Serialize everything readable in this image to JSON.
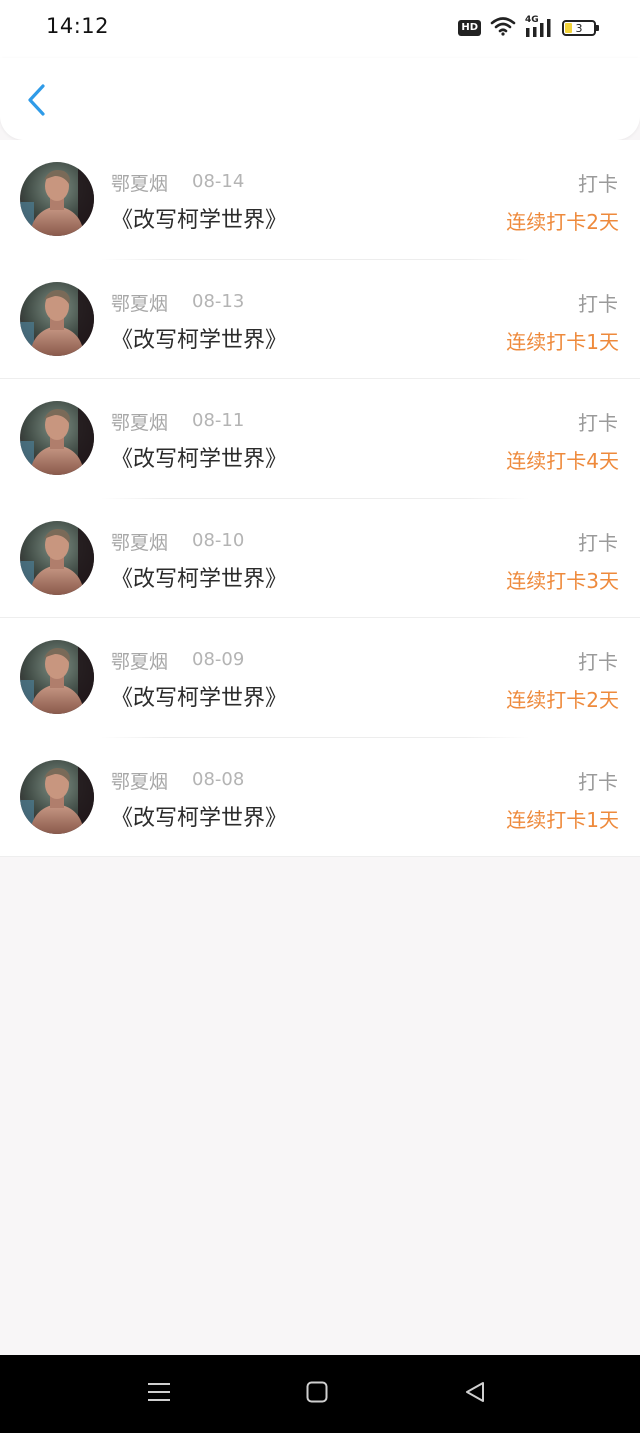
{
  "status_bar": {
    "time": "14:12",
    "hd_label": "HD",
    "network_label": "4G",
    "battery_level": "3"
  },
  "records": [
    {
      "name": "鄂夏烟",
      "date": "08-14",
      "book": "《改写柯学世界》",
      "type": "打卡",
      "streak": "连续打卡2天"
    },
    {
      "name": "鄂夏烟",
      "date": "08-13",
      "book": "《改写柯学世界》",
      "type": "打卡",
      "streak": "连续打卡1天"
    },
    {
      "name": "鄂夏烟",
      "date": "08-11",
      "book": "《改写柯学世界》",
      "type": "打卡",
      "streak": "连续打卡4天"
    },
    {
      "name": "鄂夏烟",
      "date": "08-10",
      "book": "《改写柯学世界》",
      "type": "打卡",
      "streak": "连续打卡3天"
    },
    {
      "name": "鄂夏烟",
      "date": "08-09",
      "book": "《改写柯学世界》",
      "type": "打卡",
      "streak": "连续打卡2天"
    },
    {
      "name": "鄂夏烟",
      "date": "08-08",
      "book": "《改写柯学世界》",
      "type": "打卡",
      "streak": "连续打卡1天"
    }
  ],
  "colors": {
    "accent": "#2f9be8",
    "streak": "#ee8a3c"
  }
}
